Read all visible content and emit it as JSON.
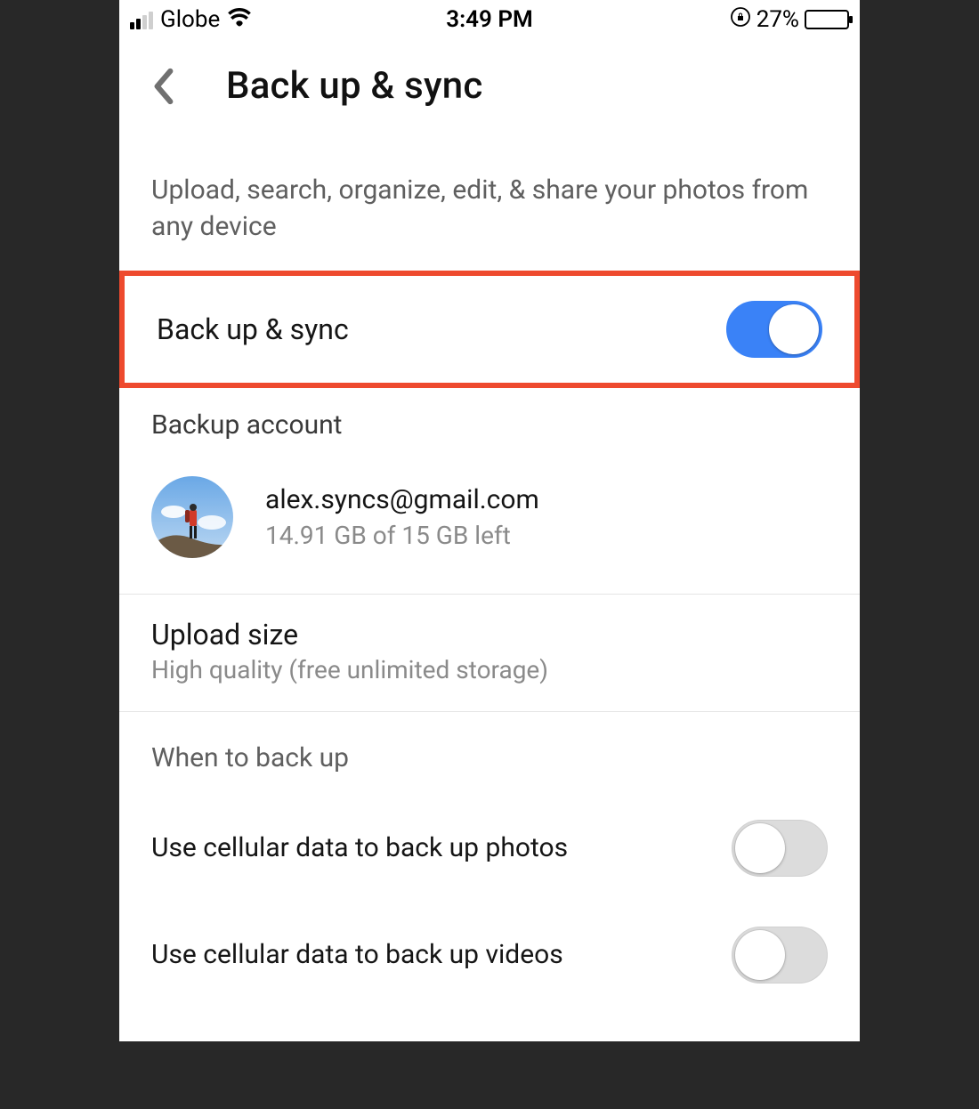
{
  "statusbar": {
    "carrier": "Globe",
    "time": "3:49 PM",
    "battery_pct": "27%"
  },
  "header": {
    "title": "Back up & sync"
  },
  "description": "Upload, search, organize, edit, & share your photos from any device",
  "toggle_row": {
    "label": "Back up & sync",
    "on": true
  },
  "backup_account": {
    "section_label": "Backup account",
    "email": "alex.syncs@gmail.com",
    "storage": "14.91 GB of 15 GB left"
  },
  "upload_size": {
    "label": "Upload size",
    "value": "High quality (free unlimited storage)"
  },
  "when_section": {
    "label": "When to back up",
    "rows": [
      {
        "label": "Use cellular data to back up photos",
        "on": false
      },
      {
        "label": "Use cellular data to back up videos",
        "on": false
      }
    ]
  }
}
